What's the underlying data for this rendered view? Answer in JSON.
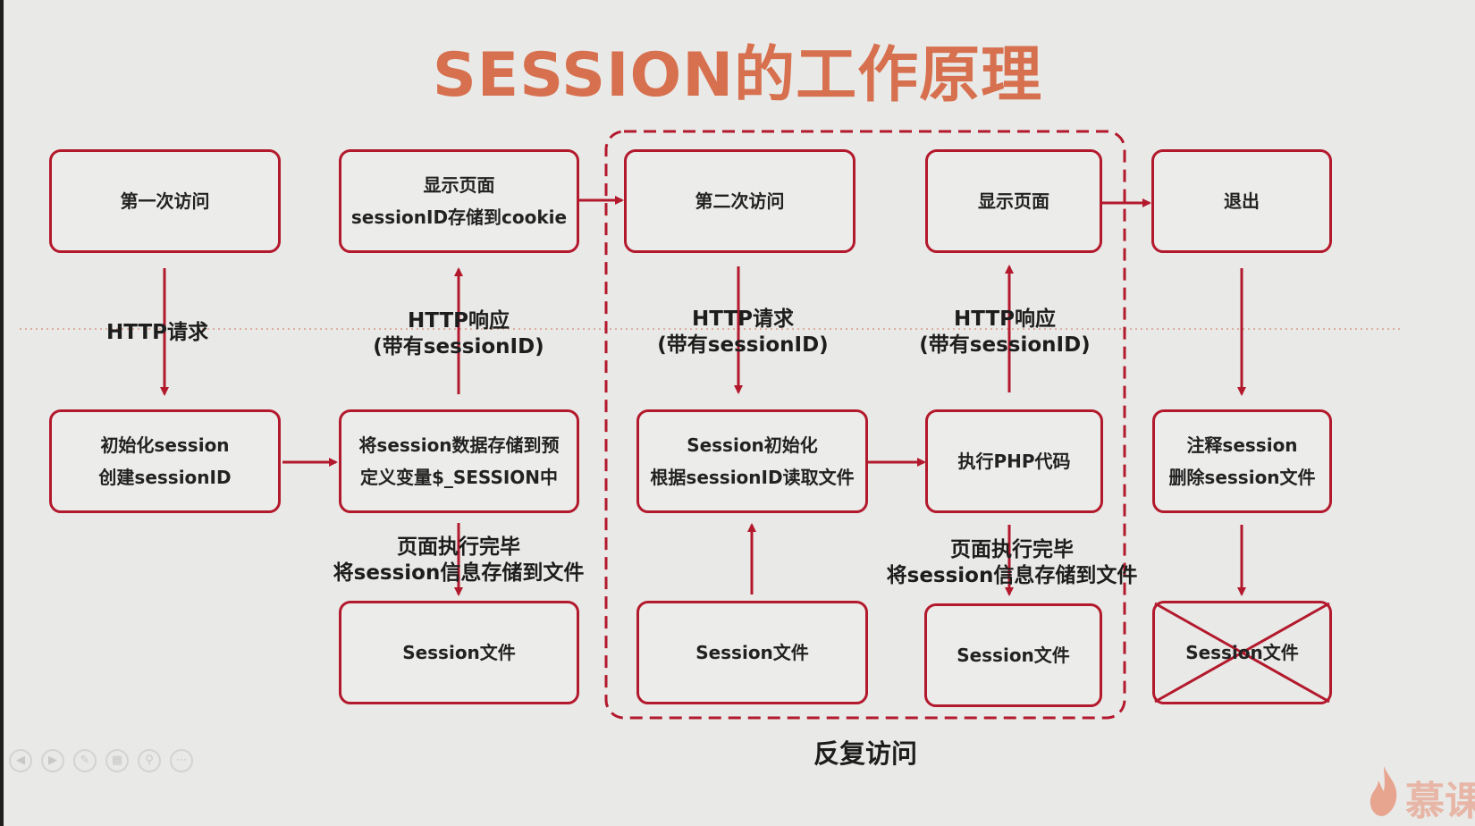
{
  "title": "SESSION的工作原理",
  "boxes": {
    "first_visit": [
      "第一次访问"
    ],
    "show_page_1": [
      "显示页面",
      "sessionID存储到cookie"
    ],
    "second_visit": [
      "第二次访问"
    ],
    "show_page_2": [
      "显示页面"
    ],
    "logout": [
      "退出"
    ],
    "init_session": [
      "初始化session",
      "创建sessionID"
    ],
    "store_vars": [
      "将session数据存储到预",
      "定义变量$_SESSION中"
    ],
    "session_init": [
      "Session初始化",
      "根据sessionID读取文件"
    ],
    "exec_php": [
      "执行PHP代码"
    ],
    "cancel_session": [
      "注释session",
      "删除session文件"
    ],
    "session_file_1": [
      "Session文件"
    ],
    "session_file_2": [
      "Session文件"
    ],
    "session_file_3": [
      "Session文件"
    ],
    "session_file_deleted": [
      "Session文件"
    ]
  },
  "labels": {
    "http_request_1": [
      "HTTP请求"
    ],
    "http_response_1": [
      "HTTP响应",
      "(带有sessionID)"
    ],
    "http_request_2": [
      "HTTP请求",
      "(带有sessionID)"
    ],
    "http_response_2": [
      "HTTP响应",
      "(带有sessionID)"
    ],
    "page_done_1": [
      "页面执行完毕",
      "将session信息存储到文件"
    ],
    "page_done_2": [
      "页面执行完毕",
      "将session信息存储到文件"
    ]
  },
  "repeat_label": "反复访问",
  "logo": "慕课",
  "controls": [
    "prev-icon",
    "next-icon",
    "pen-icon",
    "slides-icon",
    "zoom-icon",
    "more-icon"
  ],
  "colors": {
    "accent": "#b3192c",
    "title": "#d7704e",
    "background": "#e9e9e7"
  }
}
